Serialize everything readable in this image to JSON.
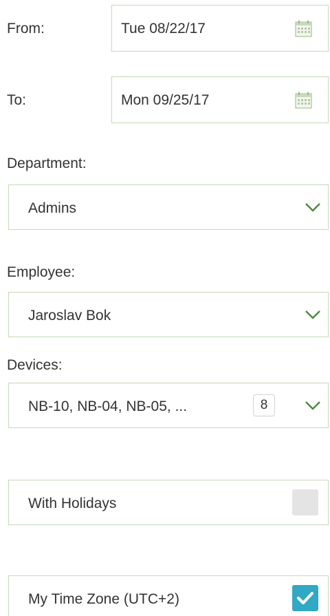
{
  "from": {
    "label": "From:",
    "value": "Tue 08/22/17",
    "icon": "calendar-icon"
  },
  "to": {
    "label": "To:",
    "value": "Mon 09/25/17",
    "icon": "calendar-icon"
  },
  "department": {
    "label": "Department:",
    "value": "Admins",
    "icon": "chevron-down-icon"
  },
  "employee": {
    "label": "Employee:",
    "value": "Jaroslav Bok",
    "icon": "chevron-down-icon"
  },
  "devices": {
    "label": "Devices:",
    "value": "NB-10, NB-04, NB-05, ...",
    "count": "8",
    "icon": "chevron-down-icon"
  },
  "holidays": {
    "label": "With Holidays",
    "checked": false
  },
  "timezone": {
    "label": "My Time Zone (UTC+2)",
    "checked": true
  },
  "colors": {
    "border": "#c5d9b5",
    "accent_green": "#4a8a3c",
    "checkbox_on": "#31a8c4",
    "checkbox_off": "#e4e4e4"
  }
}
